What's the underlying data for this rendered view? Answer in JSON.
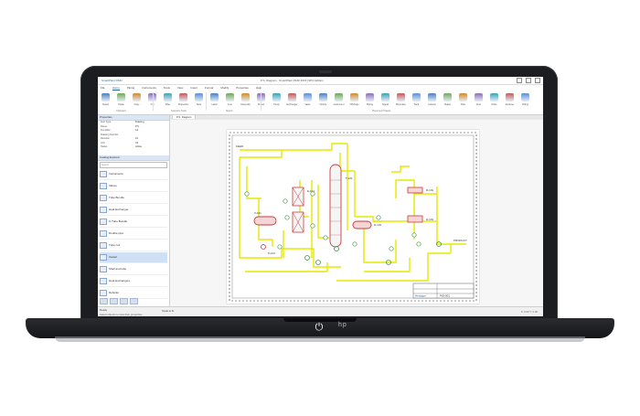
{
  "window": {
    "app_name": "SmartPlant P&ID",
    "title": "P.S. Diagram - SmartPlant P&ID 2019 (SP1) Edition"
  },
  "ribbon_tabs": [
    "File",
    "Home",
    "Piping",
    "Instruments",
    "Tools",
    "View",
    "Insert",
    "Format",
    "Modify",
    "Properties",
    "Help"
  ],
  "active_tab": "Home",
  "ribbon_groups": [
    "Clipboard",
    "Selection Tools",
    "Sketch",
    "Placement Palette"
  ],
  "ribbon_buttons": [
    "Select",
    "Paste",
    "Copy",
    "Cut",
    "Filter",
    "Properties",
    "Note",
    "Label",
    "Line",
    "Assembly",
    "Vessel",
    "Pump",
    "Exchanger",
    "Valve",
    "Nozzle",
    "Instrument",
    "Off-Page",
    "Piping",
    "Signal",
    "Boundary",
    "Tank",
    "Column",
    "Heater",
    "Filter",
    "Vent",
    "Drain",
    "Reducer",
    "Fitting"
  ],
  "left_panel": {
    "properties_header": "Properties",
    "properties": [
      {
        "k": "Item Type",
        "v": "Drawing"
      },
      {
        "k": "Name",
        "v": "P.S."
      },
      {
        "k": "Template",
        "v": "A1"
      },
      {
        "k": "Drawing Number",
        "v": ""
      },
      {
        "k": "Revision",
        "v": "01"
      },
      {
        "k": "Unit",
        "v": "U1"
      },
      {
        "k": "Status",
        "v": "Active"
      }
    ],
    "catalog_header": "Catalog Explorer",
    "search_placeholder": "Search",
    "items": [
      "Instruments",
      "Valves",
      "Tube Bundle",
      "Heat Exchanger",
      "U-Tube Bundle",
      "Double pipe",
      "Tube coil",
      "Vessel",
      "Shell and tube",
      "Heat Exchangers",
      "Reboiler"
    ],
    "selected_index": 7
  },
  "doc_tab": "P.S. Diagram",
  "status": {
    "line1": "Ready",
    "line2": "Select objects to view their properties",
    "zoom": "Scale to fit",
    "coords": "X: 0.00 Y: 0.00"
  },
  "colors": {
    "pipe": "#e6e800",
    "equipment_outline": "#c83c3c",
    "instrument": "#3d9a3d",
    "accent": "#1f5fa6"
  },
  "drawing_labels": {
    "column": "T-101",
    "vessel": "V-101",
    "exchanger": "E-101",
    "drum": "D-101",
    "pump": "P-101",
    "reactor": "R-101",
    "heater": "H-101",
    "feed": "FEED",
    "product": "PRODUCT"
  },
  "title_block": {
    "company": "Hexagon",
    "drawing_no": "PID-001"
  },
  "base": {
    "power_icon": "⏻",
    "logo": "hp"
  }
}
